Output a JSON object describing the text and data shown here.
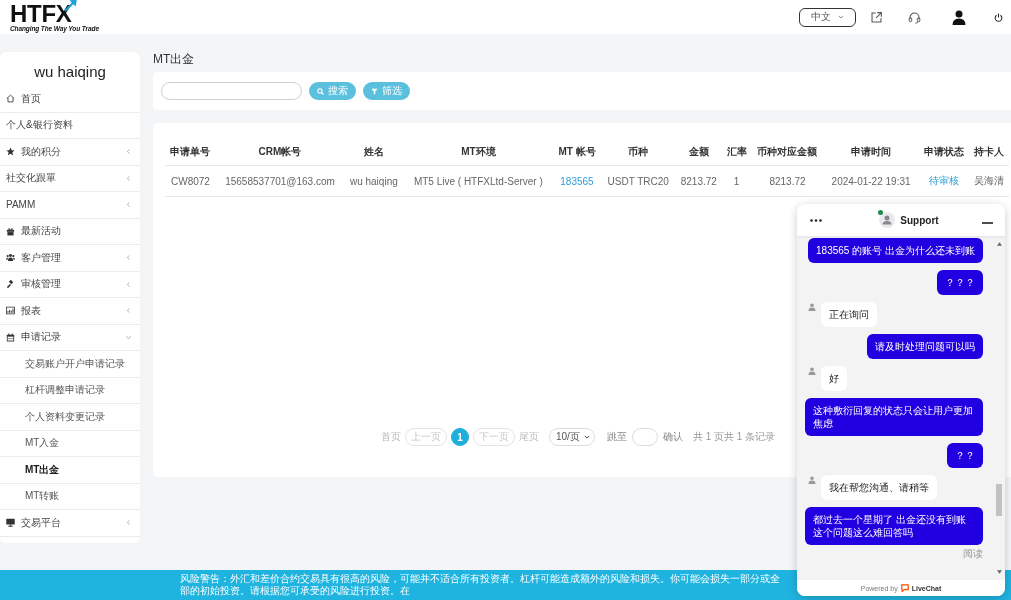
{
  "header": {
    "logo": {
      "wordmark": "HTFX",
      "tagline": "Changing The Way You Trade"
    },
    "language": "中文"
  },
  "sidebar": {
    "user_name": "wu haiqing",
    "items": [
      {
        "label": "首页",
        "kind": "link",
        "selected": false
      },
      {
        "label": "个人&银行资料",
        "kind": "link",
        "selected": false
      },
      {
        "label": "我的积分",
        "kind": "menu",
        "selected": false,
        "expanded": false
      },
      {
        "label": "社交化跟單",
        "kind": "menu",
        "selected": false,
        "expanded": false
      },
      {
        "label": "PAMM",
        "kind": "menu",
        "selected": false,
        "expanded": false
      },
      {
        "label": "最新活动",
        "kind": "link",
        "selected": false
      },
      {
        "label": "客户管理",
        "kind": "menu",
        "selected": false,
        "expanded": false
      },
      {
        "label": "审核管理",
        "kind": "menu",
        "selected": false,
        "expanded": false
      },
      {
        "label": "报表",
        "kind": "menu",
        "selected": false,
        "expanded": false
      },
      {
        "label": "申请记录",
        "kind": "menu",
        "selected": false,
        "expanded": true,
        "children": [
          {
            "label": "交易账户开户申请记录",
            "selected": false
          },
          {
            "label": "杠杆调整申请记录",
            "selected": false
          },
          {
            "label": "个人资料变更记录",
            "selected": false
          },
          {
            "label": "MT入金",
            "selected": false
          },
          {
            "label": "MT出金",
            "selected": true
          },
          {
            "label": "MT转账",
            "selected": false
          }
        ]
      },
      {
        "label": "交易平台",
        "kind": "menu",
        "selected": false,
        "expanded": false
      }
    ]
  },
  "page_title": "MT出金",
  "filter_bar": {
    "search_button": "搜索",
    "filter_button": "筛选"
  },
  "table": {
    "columns": [
      {
        "label": "申请单号",
        "kind": "text"
      },
      {
        "label": "CRM帐号",
        "kind": "text"
      },
      {
        "label": "姓名",
        "kind": "text"
      },
      {
        "label": "MT环境",
        "kind": "text"
      },
      {
        "label": "MT 帐号",
        "kind": "link"
      },
      {
        "label": "币种",
        "kind": "text"
      },
      {
        "label": "金额",
        "kind": "text"
      },
      {
        "label": "汇率",
        "kind": "text"
      },
      {
        "label": "币种对应金额",
        "kind": "text"
      },
      {
        "label": "申请时间",
        "kind": "text"
      },
      {
        "label": "申请状态",
        "kind": "link"
      },
      {
        "label": "持卡人",
        "kind": "text"
      }
    ],
    "rows": [
      {
        "cells": [
          "CW8072",
          "15658537701@163.com",
          "wu haiqing",
          "MT5 Live ( HTFXLtd-Server )",
          "183565",
          "USDT TRC20",
          "8213.72",
          "1",
          "8213.72",
          "2024-01-22 19:31",
          "待审核",
          "吴海清"
        ]
      }
    ]
  },
  "pagination": {
    "first": {
      "label": "首页",
      "disabled": true
    },
    "prev": {
      "label": "上一页",
      "disabled": true
    },
    "pages": [
      {
        "label": "1",
        "selected": true
      }
    ],
    "next": {
      "label": "下一页",
      "disabled": true
    },
    "last": {
      "label": "尾页",
      "disabled": true
    },
    "page_size": "10/页",
    "jump_label": "跳至",
    "confirm": "确认",
    "summary": "共 1 页共 1 条记录"
  },
  "chat": {
    "title": "Support",
    "online": true,
    "messages": [
      {
        "kind": "visitor",
        "text": "183565 的账号 出金为什么还未到账"
      },
      {
        "kind": "visitor",
        "text": "？？？"
      },
      {
        "kind": "agent",
        "text": "正在询问"
      },
      {
        "kind": "visitor",
        "text": "请及时处理问题可以吗"
      },
      {
        "kind": "agent",
        "text": "好"
      },
      {
        "kind": "visitor",
        "text": "这种敷衍回复的状态只会让用户更加焦虑"
      },
      {
        "kind": "visitor",
        "text": "？？"
      },
      {
        "kind": "agent",
        "text": "我在帮您沟通、请稍等"
      },
      {
        "kind": "visitor",
        "text": "都过去一个星期了 出金还没有到账这个问题这么难回答吗"
      }
    ],
    "read_receipt": "阅读",
    "powered_by": "Powered by",
    "brand": "LiveChat"
  },
  "footer": {
    "risk_warning": "风险警告：外汇和差价合约交易具有很高的风险，可能并不适合所有投资者。杠杆可能造成额外的风险和损失。你可能会损失一部分或全部的初始投资。请根据您可承受的风险进行投资。在"
  }
}
